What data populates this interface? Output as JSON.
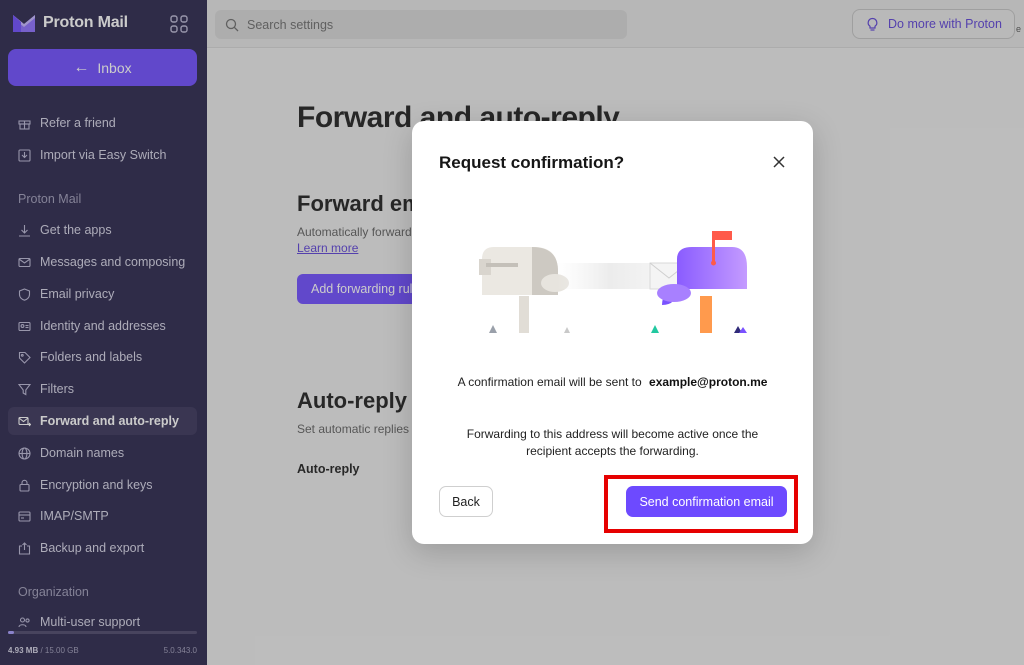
{
  "brand": {
    "name": "Proton Mail"
  },
  "sidebar": {
    "inbox_label": "Inbox",
    "top_items": [
      {
        "label": "Refer a friend",
        "icon": "gift-icon"
      },
      {
        "label": "Import via Easy Switch",
        "icon": "import-icon"
      }
    ],
    "section_mail": "Proton Mail",
    "items": [
      {
        "label": "Get the apps",
        "icon": "download-icon"
      },
      {
        "label": "Messages and composing",
        "icon": "envelope-icon"
      },
      {
        "label": "Email privacy",
        "icon": "shield-icon"
      },
      {
        "label": "Identity and addresses",
        "icon": "id-card-icon"
      },
      {
        "label": "Folders and labels",
        "icon": "tag-icon"
      },
      {
        "label": "Filters",
        "icon": "filter-icon"
      },
      {
        "label": "Forward and auto-reply",
        "icon": "forward-icon",
        "active": true
      },
      {
        "label": "Domain names",
        "icon": "globe-icon"
      },
      {
        "label": "Encryption and keys",
        "icon": "lock-icon"
      },
      {
        "label": "IMAP/SMTP",
        "icon": "server-icon"
      },
      {
        "label": "Backup and export",
        "icon": "export-icon"
      }
    ],
    "section_org": "Organization",
    "org_items": [
      {
        "label": "Multi-user support",
        "icon": "users-icon"
      }
    ],
    "storage_used": "4.93 MB",
    "storage_total": "/ 15.00 GB",
    "storage_fraction": 0.03,
    "version": "5.0.343.0"
  },
  "topbar": {
    "search_placeholder": "Search settings",
    "do_more_label": "Do more with Proton",
    "cut_text": "e"
  },
  "main": {
    "title": "Forward and auto-reply",
    "forward_heading": "Forward email",
    "forward_desc": "Automatically forward",
    "learn_more": "Learn more",
    "add_rule": "Add forwarding rule",
    "auto_heading": "Auto-reply",
    "auto_desc": "Set automatic replies",
    "auto_label": "Auto-reply"
  },
  "modal": {
    "title": "Request confirmation?",
    "line1_prefix": "A confirmation email will be sent to",
    "email": "example@proton.me",
    "line2": "Forwarding to this address will become active once the recipient accepts the forwarding.",
    "back_label": "Back",
    "send_label": "Send confirmation email"
  },
  "colors": {
    "accent": "#6d4aff",
    "sidebar_bg": "#27234a",
    "highlight": "#e60000"
  }
}
